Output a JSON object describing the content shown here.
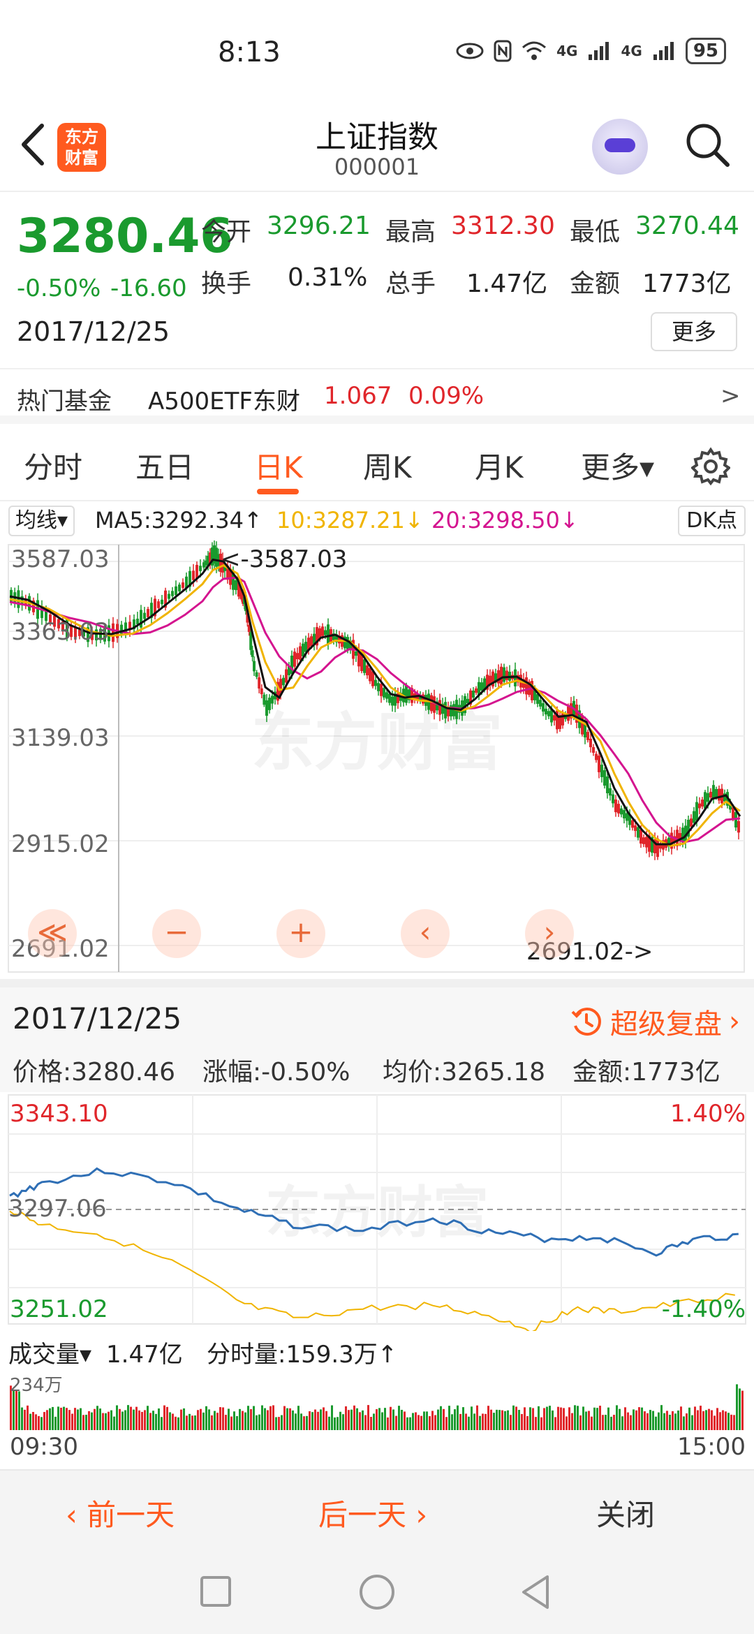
{
  "status": {
    "time": "8:13",
    "battery": "95",
    "net1": "4G",
    "net2": "4G"
  },
  "header": {
    "title": "上证指数",
    "code": "000001",
    "logo_text": "东方财富"
  },
  "quote": {
    "price": "3280.46",
    "change_pct": "-0.50%",
    "change": "-16.60",
    "date": "2017/12/25",
    "open_label": "今开",
    "open": "3296.21",
    "high_label": "最高",
    "high": "3312.30",
    "low_label": "最低",
    "low": "3270.44",
    "turnover_label": "换手",
    "turnover": "0.31%",
    "volume_label": "总手",
    "volume": "1.47亿",
    "amount_label": "金额",
    "amount": "1773亿",
    "more_label": "更多"
  },
  "fund": {
    "label": "热门基金",
    "name": "A500ETF东财",
    "price": "1.067",
    "pct": "0.09%",
    "arrow": ">"
  },
  "tabs": [
    "分时",
    "五日",
    "日K",
    "周K",
    "月K",
    "更多▾"
  ],
  "active_tab": "日K",
  "ma": {
    "selector": "均线▾",
    "ma5": "MA5:3292.34↑",
    "ma10": "10:3287.21↓",
    "ma20": "20:3298.50↓",
    "dk": "DK点"
  },
  "kchart": {
    "y_ticks": [
      "3587.03",
      "3363.03",
      "3139.03",
      "2915.02",
      "2691.02"
    ],
    "max_label": "<-3587.03",
    "min_label": "2691.02->",
    "watermark": "东方财富",
    "controls": [
      "≪",
      "−",
      "+",
      "‹",
      "›"
    ]
  },
  "detail": {
    "date": "2017/12/25",
    "replay": "超级复盘",
    "price": "价格:3280.46",
    "pct": "涨幅:-0.50%",
    "avg": "均价:3265.18",
    "amount": "金额:1773亿"
  },
  "tchart": {
    "top": "3343.10",
    "mid": "3297.06",
    "bottom": "3251.02",
    "top_pct": "1.40%",
    "bottom_pct": "-1.40%"
  },
  "vol": {
    "selector": "成交量▾",
    "total": "1.47亿",
    "last": "分时量:159.3万↑",
    "axis": "234万"
  },
  "times": {
    "start": "09:30",
    "end": "15:00"
  },
  "actions": {
    "prev": "‹ 前一天",
    "next": "后一天 ›",
    "close": "关闭"
  },
  "colors": {
    "up": "#e0262b",
    "down": "#1a9a2e",
    "accent": "#ff5a1f",
    "ma5": "#000000",
    "ma10": "#f0b400",
    "ma20": "#d4148f"
  }
}
